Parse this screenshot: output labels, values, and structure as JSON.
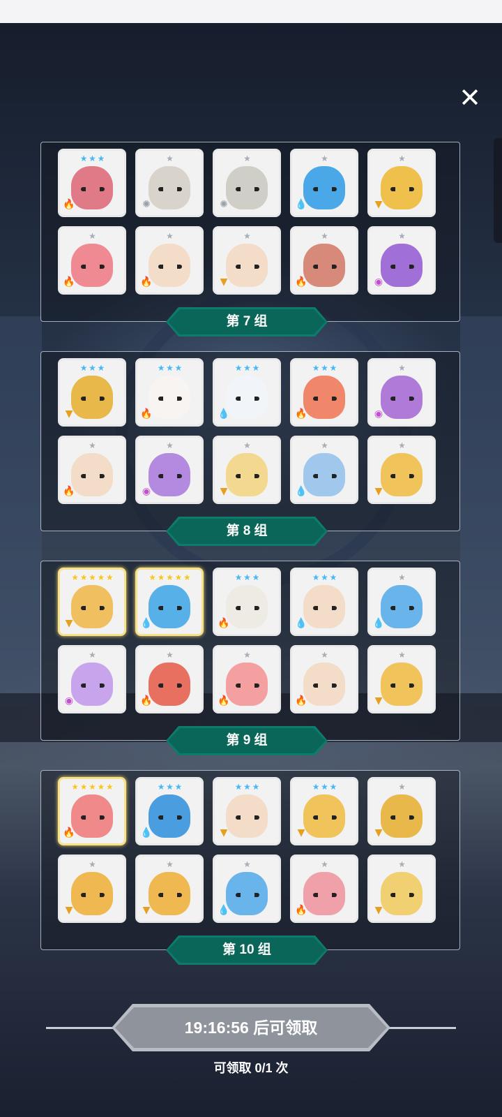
{
  "close_icon": "close-icon",
  "colors": {
    "star_blue": "#4fb7ef",
    "star_gray": "#a9adb5",
    "star_gold": "#f4c531",
    "fire": "#e5502d",
    "water": "#2f8fe0",
    "wind": "#e6a020",
    "light": "#9aa0a8",
    "arcane": "#c14fd0",
    "banner": "#0d7c6c"
  },
  "groups": [
    {
      "label": "第 7 组",
      "heroes": [
        {
          "stars": 3,
          "star_color": "blue",
          "element": "fire",
          "color": "#e07a86"
        },
        {
          "stars": 1,
          "star_color": "gray",
          "element": "light",
          "color": "#d8d4cc"
        },
        {
          "stars": 1,
          "star_color": "gray",
          "element": "light",
          "color": "#cfcfc8"
        },
        {
          "stars": 1,
          "star_color": "gray",
          "element": "water",
          "color": "#4aa8e8"
        },
        {
          "stars": 1,
          "star_color": "gray",
          "element": "wind",
          "color": "#f0c04c"
        },
        {
          "stars": 1,
          "star_color": "gray",
          "element": "fire",
          "color": "#f08a92"
        },
        {
          "stars": 1,
          "star_color": "gray",
          "element": "fire",
          "color": "#f3dcc8"
        },
        {
          "stars": 1,
          "star_color": "gray",
          "element": "wind",
          "color": "#f3dcc8"
        },
        {
          "stars": 1,
          "star_color": "gray",
          "element": "fire",
          "color": "#d88a7a"
        },
        {
          "stars": 1,
          "star_color": "gray",
          "element": "arcane",
          "color": "#a070d8"
        }
      ]
    },
    {
      "label": "第 8 组",
      "heroes": [
        {
          "stars": 3,
          "star_color": "blue",
          "element": "wind",
          "color": "#e8b84a"
        },
        {
          "stars": 3,
          "star_color": "blue",
          "element": "fire",
          "color": "#f7f4f2"
        },
        {
          "stars": 3,
          "star_color": "blue",
          "element": "water",
          "color": "#f1f5fa"
        },
        {
          "stars": 3,
          "star_color": "blue",
          "element": "fire",
          "color": "#f0866a"
        },
        {
          "stars": 1,
          "star_color": "gray",
          "element": "arcane",
          "color": "#b07ad8"
        },
        {
          "stars": 1,
          "star_color": "gray",
          "element": "fire",
          "color": "#f3dcc8"
        },
        {
          "stars": 1,
          "star_color": "gray",
          "element": "arcane",
          "color": "#b48ae0"
        },
        {
          "stars": 1,
          "star_color": "gray",
          "element": "wind",
          "color": "#f3d890"
        },
        {
          "stars": 1,
          "star_color": "gray",
          "element": "water",
          "color": "#9fc8ec"
        },
        {
          "stars": 1,
          "star_color": "gray",
          "element": "wind",
          "color": "#f0c45a"
        }
      ]
    },
    {
      "label": "第 9 组",
      "heroes": [
        {
          "stars": 5,
          "star_color": "gold",
          "element": "wind",
          "color": "#f0c060",
          "gold": true
        },
        {
          "stars": 5,
          "star_color": "gold",
          "element": "water",
          "color": "#58b0e8",
          "gold": true
        },
        {
          "stars": 3,
          "star_color": "blue",
          "element": "fire",
          "color": "#eeeae4"
        },
        {
          "stars": 3,
          "star_color": "blue",
          "element": "water",
          "color": "#f3dcc8"
        },
        {
          "stars": 1,
          "star_color": "gray",
          "element": "water",
          "color": "#6ab4ec"
        },
        {
          "stars": 1,
          "star_color": "gray",
          "element": "arcane",
          "color": "#c8a4ec"
        },
        {
          "stars": 1,
          "star_color": "gray",
          "element": "fire",
          "color": "#e87060"
        },
        {
          "stars": 1,
          "star_color": "gray",
          "element": "fire",
          "color": "#f4a0a0"
        },
        {
          "stars": 1,
          "star_color": "gray",
          "element": "fire",
          "color": "#f3dcc8"
        },
        {
          "stars": 1,
          "star_color": "gray",
          "element": "wind",
          "color": "#f0c45a"
        }
      ]
    },
    {
      "label": "第 10 组",
      "heroes": [
        {
          "stars": 5,
          "star_color": "gold",
          "element": "fire",
          "color": "#f08a8a",
          "gold": true
        },
        {
          "stars": 3,
          "star_color": "blue",
          "element": "water",
          "color": "#4a9ee0"
        },
        {
          "stars": 3,
          "star_color": "blue",
          "element": "wind",
          "color": "#f3dcc8"
        },
        {
          "stars": 3,
          "star_color": "blue",
          "element": "wind",
          "color": "#f0c45a"
        },
        {
          "stars": 1,
          "star_color": "gray",
          "element": "wind",
          "color": "#e8b84a"
        },
        {
          "stars": 1,
          "star_color": "gray",
          "element": "wind",
          "color": "#f0b850"
        },
        {
          "stars": 1,
          "star_color": "gray",
          "element": "wind",
          "color": "#f0b850"
        },
        {
          "stars": 1,
          "star_color": "gray",
          "element": "water",
          "color": "#6ab4ec"
        },
        {
          "stars": 1,
          "star_color": "gray",
          "element": "fire",
          "color": "#f0a0a8"
        },
        {
          "stars": 1,
          "star_color": "gray",
          "element": "wind",
          "color": "#f0d070"
        }
      ]
    }
  ],
  "claim_button": {
    "label": "19:16:56 后可领取"
  },
  "claim_count": "可领取 0/1 次"
}
